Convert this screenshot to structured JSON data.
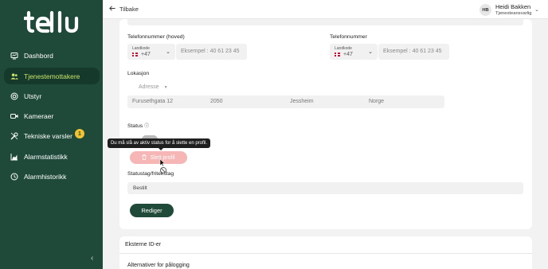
{
  "sidebar": {
    "logo": "tellu",
    "items": [
      {
        "label": "Dashbord",
        "icon": "dashboard-icon"
      },
      {
        "label": "Tjenestemottakere",
        "icon": "users-icon"
      },
      {
        "label": "Utstyr",
        "icon": "device-icon"
      },
      {
        "label": "Kameraer",
        "icon": "camera-icon"
      },
      {
        "label": "Tekniske varsler",
        "icon": "wrench-icon"
      },
      {
        "label": "Alarmstatistikk",
        "icon": "chart-icon"
      },
      {
        "label": "Alarmhistorikk",
        "icon": "clock-icon"
      }
    ],
    "badge_count": "1",
    "collapse_icon": "chevron-left-icon"
  },
  "topbar": {
    "back_label": "Tilbake",
    "user": {
      "initials": "HB",
      "name": "Heidi Bakken",
      "role": "Tjenesteansvarlig"
    }
  },
  "form": {
    "phone_main": {
      "label": "Telefonnummer (hoved)",
      "prefix_label": "Landkode",
      "prefix_value": "+47",
      "placeholder": "Eksempel : 40 61 23 45"
    },
    "phone": {
      "label": "Telefonnummer",
      "prefix_label": "Landkode",
      "prefix_value": "+47",
      "placeholder": "Eksempel : 40 61 23 45"
    },
    "location": {
      "label": "Lokasjon",
      "dropdown": "Adresse",
      "street": "Furusethgata 12",
      "zip": "2050",
      "city": "Jessheim",
      "country": "Norge"
    },
    "status": {
      "label": "Status",
      "tooltip": "Du må slå av aktiv status for å slette en profil.",
      "delete_label": "Slett profil"
    },
    "tags": {
      "label": "Statustag/fritekstag",
      "value": "Bestilt"
    },
    "edit_label": "Rediger"
  },
  "external": {
    "title": "Eksterne ID-er",
    "login_title": "Alternativer for pålogging"
  },
  "colors": {
    "sidebar": "#1f4a3a",
    "active_text": "#c9e36b",
    "badge": "#f1c232",
    "delete": "#f6b6b6"
  }
}
